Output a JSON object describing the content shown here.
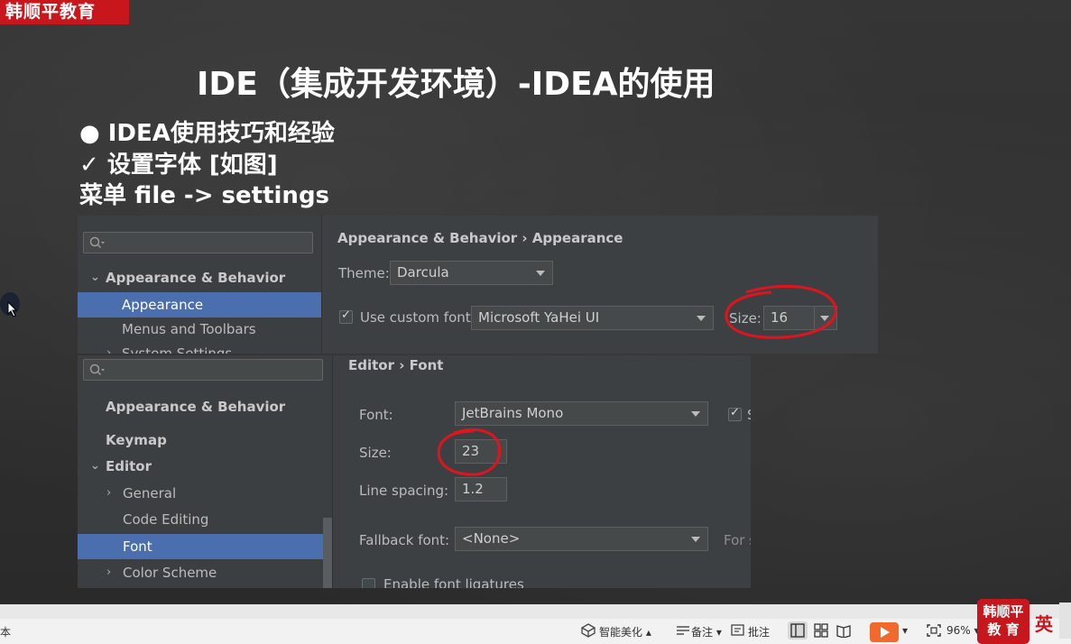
{
  "slide": {
    "logo_tl": "韩顺平教育",
    "title": "IDE（集成开发环境）-IDEA的使用",
    "bullet1": "●  IDEA使用技巧和经验",
    "bullet2": "✓  设置字体 [如图]",
    "bullet3": "菜单 file -> settings"
  },
  "settings_appearance": {
    "tree": {
      "group": "Appearance & Behavior",
      "items": [
        "Appearance",
        "Menus and Toolbars",
        "System Settings"
      ]
    },
    "breadcrumb": "Appearance & Behavior  ›  Appearance",
    "theme_label": "Theme:",
    "theme_value": "Darcula",
    "custom_font_label": "Use custom font:",
    "custom_font_value": "Microsoft YaHei UI",
    "size_label": "Size:",
    "size_value": "16"
  },
  "settings_editor_font": {
    "tree": {
      "group1": "Appearance & Behavior",
      "group2": "Keymap",
      "group3": "Editor",
      "items": [
        "General",
        "Code Editing",
        "Font",
        "Color Scheme"
      ]
    },
    "breadcrumb": "Editor  ›  Font",
    "font_label": "Font:",
    "font_value": "JetBrains Mono",
    "size_label": "Size:",
    "size_value": "23",
    "line_spacing_label": "Line spacing:",
    "line_spacing_value": "1.2",
    "fallback_label": "Fallback font:",
    "fallback_value": "<None>",
    "fallback_hint": "For s",
    "ligatures_label": "Enable font ligatures",
    "partial_s": "S"
  },
  "statusbar": {
    "left_text": "本",
    "smart_beautify": "智能美化",
    "notes": "备注",
    "comments": "批注",
    "zoom": "96%",
    "logo_br_line1": "韩顺平",
    "logo_br_line2": "教 育",
    "ime": "英"
  },
  "colors": {
    "ide_bg": "#3c3f41",
    "selection": "#4b6eaf",
    "highlight_circle": "#e0141e",
    "brand_red": "#c8161d"
  }
}
